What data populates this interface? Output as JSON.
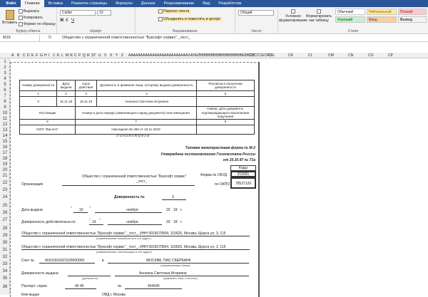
{
  "tabs": [
    "Файл",
    "Главная",
    "Вставка",
    "Разметка страницы",
    "Формулы",
    "Данные",
    "Рецензирование",
    "Вид",
    "Разработчик"
  ],
  "ribbon": {
    "clipboard": {
      "paste": "Вставить",
      "cut": "Вырезать",
      "copy": "Копировать",
      "painter": "Формат по образцу",
      "label": "Буфер обмена"
    },
    "font": {
      "name": "Calibri",
      "size": "10",
      "label": "Шрифт"
    },
    "align": {
      "wrap": "Перенос текста",
      "merge": "Объединить и поместить в центре",
      "label": "Выравнивание"
    },
    "number": {
      "format": "Общий",
      "label": "Число"
    },
    "styles": {
      "cond": "Условное форматирование",
      "table": "Форматировать как таблицу",
      "normal": "Обычный",
      "neutral": "Нейтральный",
      "bad": "Плохой",
      "good": "Хороший",
      "input": "Ввод",
      "output": "Вывод",
      "label": "Стили"
    }
  },
  "formula_bar": {
    "cell": "M19",
    "fx": "fx",
    "value": "Общество с ограниченной ответственностью \"Буксофт сервис\" _тест_"
  },
  "col_headers": [
    "A",
    "B",
    "C",
    "D",
    "E",
    "F",
    "G",
    "H",
    "I",
    "J",
    "K",
    "L",
    "M",
    "N",
    "C",
    "P",
    "Q",
    "R",
    "ST",
    "U",
    "V",
    "X",
    "Y",
    "Z",
    "AAAAAAAAAAAAAAAAAAAAAAAAAXAYAZBBBBBBBBBBBBBBBBBBEBBCCCCCECFCG",
    "CH",
    "CI",
    "CK",
    "CL",
    "CM",
    "CN",
    "CO",
    "CP"
  ],
  "rows": [
    "1",
    "2",
    "3",
    "4",
    "5",
    "6",
    "7",
    "8",
    "9",
    "10",
    "11",
    "12",
    "13",
    "14",
    "15",
    "16",
    "17",
    "18",
    "19",
    "20",
    "21",
    "22",
    "23",
    "24",
    "25",
    "26",
    "27",
    "28",
    "29",
    "30",
    "31",
    "32",
    "33",
    "34",
    "35",
    "36"
  ],
  "form": {
    "table": {
      "h": [
        "Номер доверенности",
        "Дата выдачи",
        "Срок действия",
        "Должность и фамилия лица, которому выдана доверенность",
        "Расписка в получении доверенности"
      ],
      "n": [
        "1",
        "2",
        "3",
        "4",
        "5"
      ],
      "v": [
        "3",
        "16.11.18",
        "19.11.18",
        "Анохина Светлана Игоревна",
        ""
      ],
      "h2": [
        "Поставщик",
        "Номер и дата наряда (заменяющего наряд документа) или извещения",
        "Номер, дата документа, подтверждающего выполнение поручения"
      ],
      "n2": [
        "6",
        "7",
        "8"
      ],
      "v2": [
        "ООО \"Васлен\"",
        "Накладная № 456 от 16.11.2018",
        ""
      ]
    },
    "cut_line": "Л и н и я   о т р е з а",
    "typical": "Типовая межотраслевая форма № М-2",
    "approved": "Утверждена постановлением Госкомстата России",
    "approved_date": "от 30.10.97 № 71а",
    "codes": "Коды",
    "okud_label": "Форма по ОКУД",
    "okud": "315001",
    "okpo_label": "по ОКПО",
    "okpo": "78537126",
    "org_name": "Общество с ограниченной ответственностью \"Буксофт сервис\"",
    "org_test": "_тест_",
    "org_label": "Организация",
    "title": "Доверенность №",
    "number": "3",
    "issue_label": "Дата выдачи",
    "issue_day": "16",
    "issue_month": "ноября",
    "issue_year": "18",
    "valid_label": "Доверенность действительна по",
    "valid_day": "19",
    "valid_month": "ноября",
    "valid_year": "18",
    "q": "\"",
    "year_prefix": "20",
    "year_suffix": "г.",
    "consumer": "Общество с ограниченной ответственностью \"Буксофт сервис\" _тест_, ИНН 9915670504, 119620, Москва, Щорса ул, 3, 115",
    "consumer_cap": "(наименование потребителя и его адрес)",
    "payer": "Общество с ограниченной ответственностью \"Буксофт сервис\" _тест_, ИНН 9915670504, 119620, Москва, Щорса ул, 3, 115",
    "payer_cap": "(наименование плательщика и его адрес)",
    "account_label": "Счет №",
    "account": "40101810921100000000",
    "bank_in": "в",
    "bank": "МОСКВА, ПАО СБЕРБАНК",
    "bank_cap": "(наименование банка)",
    "issued_label": "Доверенность выдана",
    "issued_person": "Анохина Светлана Игоревна",
    "pos_cap": "(должность)",
    "fio_cap": "(фамилия, имя, отчество)",
    "passport_label": "Паспорт: серия",
    "series": "45 45",
    "num_label": "№",
    "passport_num": "454545",
    "by_label": "Кем выдан",
    "by": "ОВД г. Москва"
  }
}
